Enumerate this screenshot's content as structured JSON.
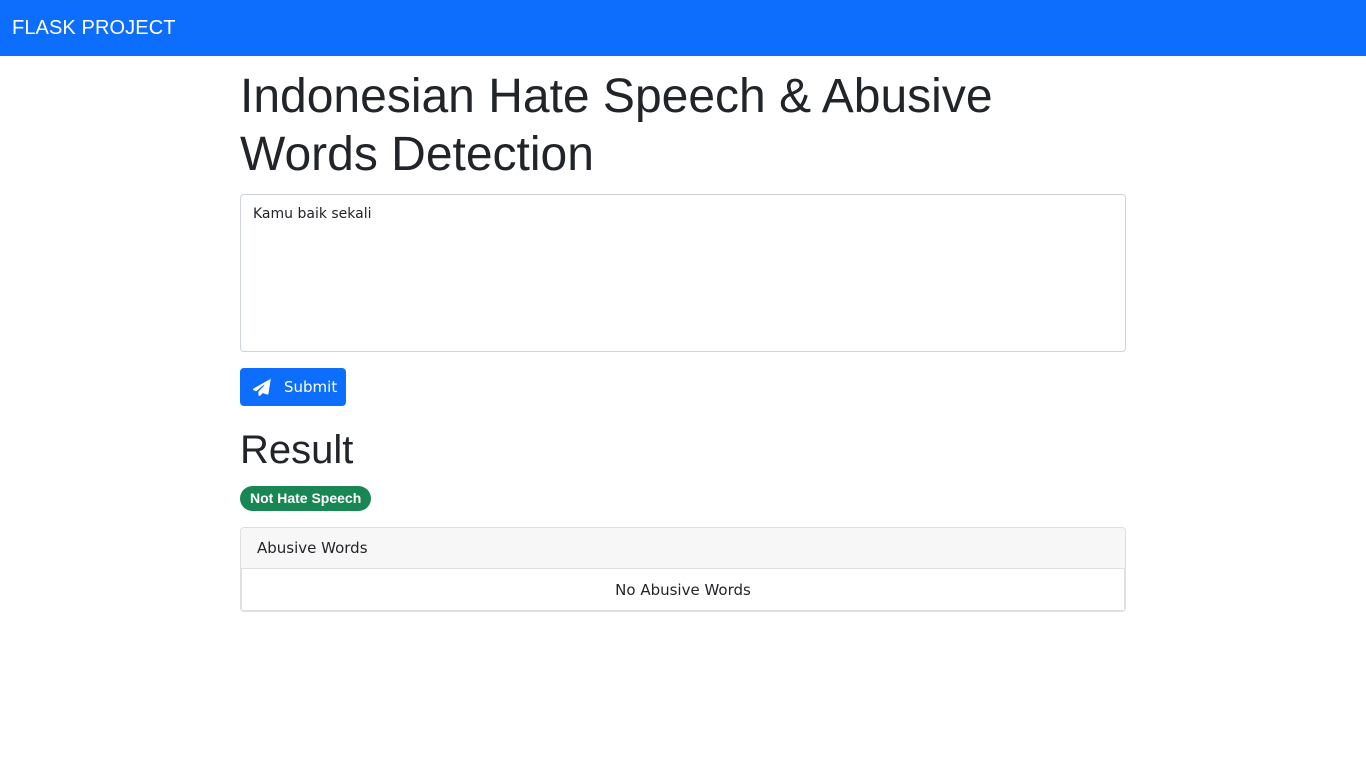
{
  "navbar": {
    "brand": "FLASK PROJECT"
  },
  "main": {
    "title": "Indonesian Hate Speech & Abusive Words Detection",
    "textarea_value": "Kamu baik sekali",
    "submit_label": "Submit",
    "submit_icon": "paper-plane-icon",
    "result_heading": "Result",
    "result_badge": "Not Hate Speech",
    "abusive_card": {
      "header": "Abusive Words",
      "body": "No Abusive Words"
    }
  },
  "colors": {
    "primary": "#0d6efd",
    "success": "#198754"
  }
}
